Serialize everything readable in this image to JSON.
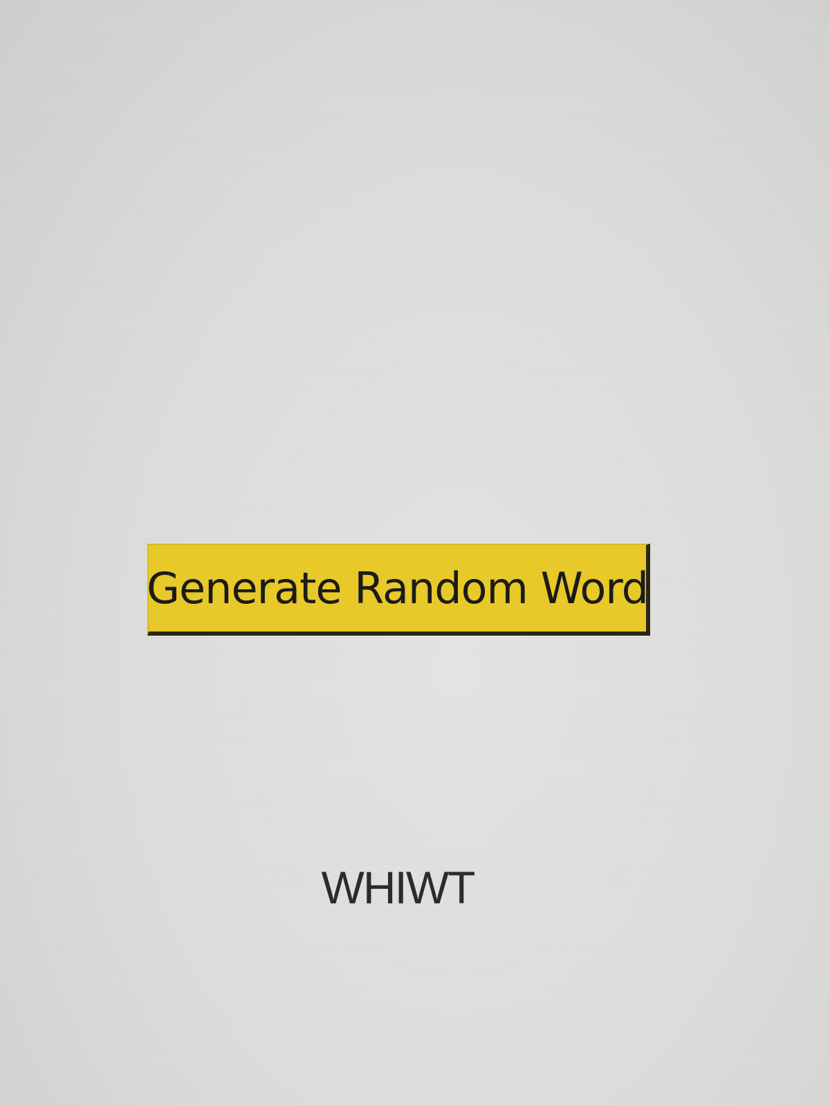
{
  "app": {
    "button_label": "Generate Random Word",
    "generated_word": "WHIWT"
  },
  "colors": {
    "background": "#dcdddb",
    "button_fill": "#e8c92a",
    "button_text": "#1c1b16",
    "word_text": "#2b2b2b"
  }
}
